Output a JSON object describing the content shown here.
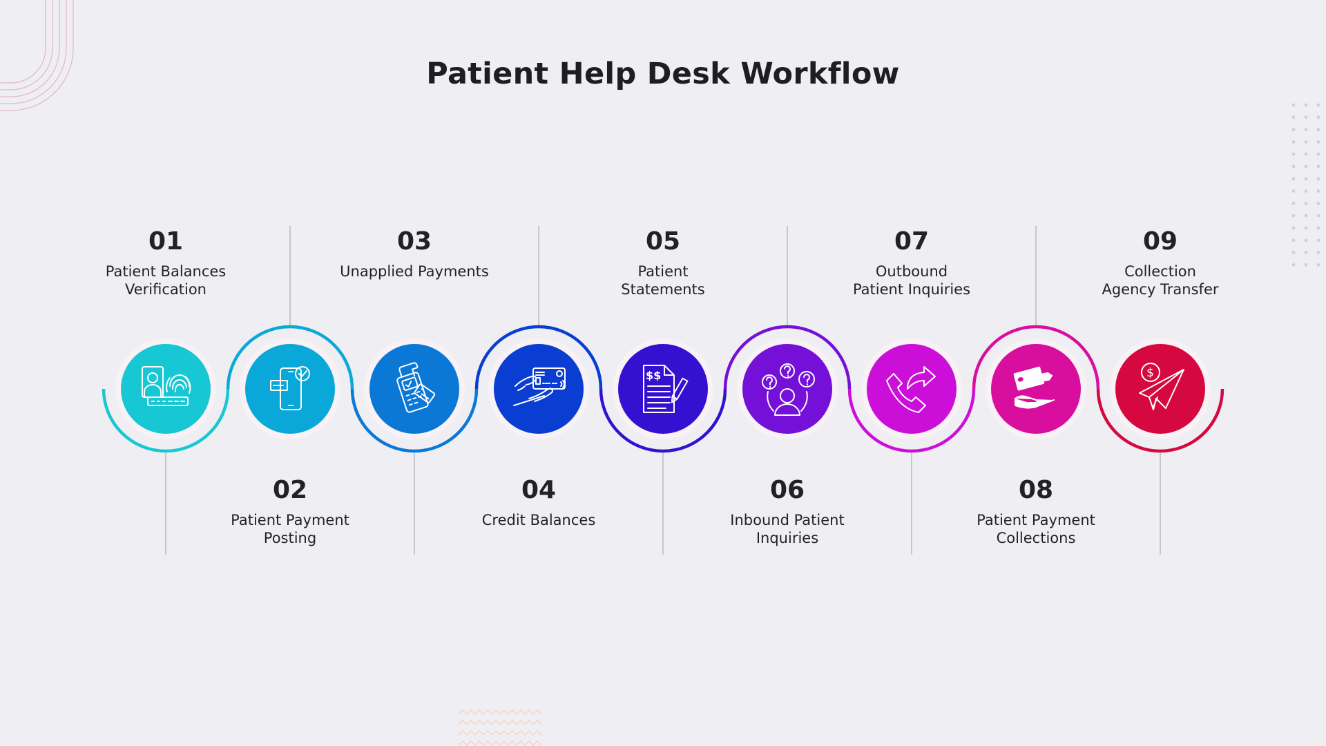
{
  "title": "Patient Help Desk Workflow",
  "steps": [
    {
      "number": "01",
      "label_lines": [
        "Patient Balances",
        "Verification"
      ],
      "icon": "id-fingerprint-password-icon",
      "color": "#17c7d3",
      "position": "top"
    },
    {
      "number": "02",
      "label_lines": [
        "Patient Payment",
        "Posting"
      ],
      "icon": "mobile-payment-check-icon",
      "color": "#0aa8d8",
      "position": "bottom"
    },
    {
      "number": "03",
      "label_lines": [
        "Unapplied Payments"
      ],
      "icon": "card-terminal-receipt-icon",
      "color": "#0b78d6",
      "position": "top"
    },
    {
      "number": "04",
      "label_lines": [
        "Credit Balances"
      ],
      "icon": "hand-credit-card-icon",
      "color": "#0a3ed2",
      "position": "bottom"
    },
    {
      "number": "05",
      "label_lines": [
        "Patient",
        "Statements"
      ],
      "icon": "statement-document-pen-icon",
      "color": "#3410d0",
      "position": "top"
    },
    {
      "number": "06",
      "label_lines": [
        "Inbound Patient",
        "Inquiries"
      ],
      "icon": "person-questions-icon",
      "color": "#7410d8",
      "position": "bottom"
    },
    {
      "number": "07",
      "label_lines": [
        "Outbound",
        "Patient Inquiries"
      ],
      "icon": "phone-outgoing-arrow-icon",
      "color": "#cc0fd8",
      "position": "top"
    },
    {
      "number": "08",
      "label_lines": [
        "Patient Payment",
        "Collections"
      ],
      "icon": "hand-card-cash-icon",
      "color": "#d80e9e",
      "position": "bottom"
    },
    {
      "number": "09",
      "label_lines": [
        "Collection",
        "Agency Transfer"
      ],
      "icon": "paper-plane-dollar-icon",
      "color": "#d5083f",
      "position": "top"
    }
  ],
  "colors": {
    "background": "#efeff3",
    "text": "#222226",
    "connector_line": "#b9b9c0",
    "ring": "#f8f1f6"
  }
}
